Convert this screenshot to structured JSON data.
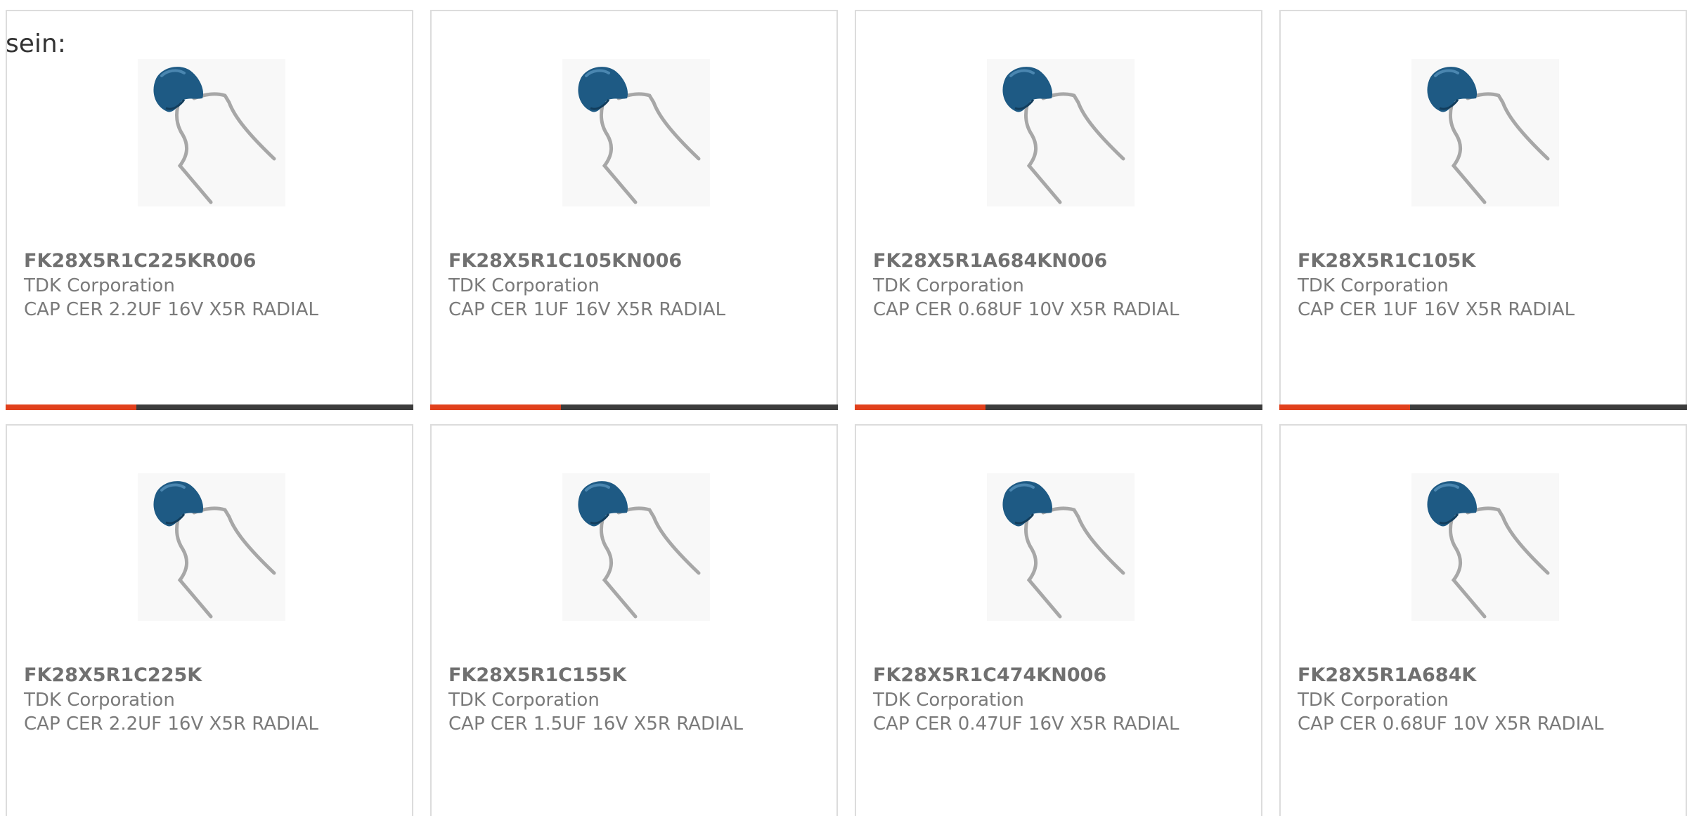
{
  "intro_text": "sein:",
  "colors": {
    "accent": "#e1401c",
    "bar_track": "#3c3c3c",
    "card_border": "#dcdcdc",
    "capacitor_body": "#1e5a84",
    "lead_wire": "#a7a7a7"
  },
  "image_icon": "radial-ceramic-capacitor",
  "products": [
    {
      "part_number": "FK28X5R1C225KR006",
      "manufacturer": "TDK Corporation",
      "description": "CAP CER 2.2UF 16V X5R RADIAL",
      "progress": 0.32
    },
    {
      "part_number": "FK28X5R1C105KN006",
      "manufacturer": "TDK Corporation",
      "description": "CAP CER 1UF 16V X5R RADIAL",
      "progress": 0.32
    },
    {
      "part_number": "FK28X5R1A684KN006",
      "manufacturer": "TDK Corporation",
      "description": "CAP CER 0.68UF 10V X5R RADIAL",
      "progress": 0.32
    },
    {
      "part_number": "FK28X5R1C105K",
      "manufacturer": "TDK Corporation",
      "description": "CAP CER 1UF 16V X5R RADIAL",
      "progress": 0.32
    },
    {
      "part_number": "FK28X5R1C225K",
      "manufacturer": "TDK Corporation",
      "description": "CAP CER 2.2UF 16V X5R RADIAL"
    },
    {
      "part_number": "FK28X5R1C155K",
      "manufacturer": "TDK Corporation",
      "description": "CAP CER 1.5UF 16V X5R RADIAL"
    },
    {
      "part_number": "FK28X5R1C474KN006",
      "manufacturer": "TDK Corporation",
      "description": "CAP CER 0.47UF 16V X5R RADIAL"
    },
    {
      "part_number": "FK28X5R1A684K",
      "manufacturer": "TDK Corporation",
      "description": "CAP CER 0.68UF 10V X5R RADIAL"
    }
  ]
}
